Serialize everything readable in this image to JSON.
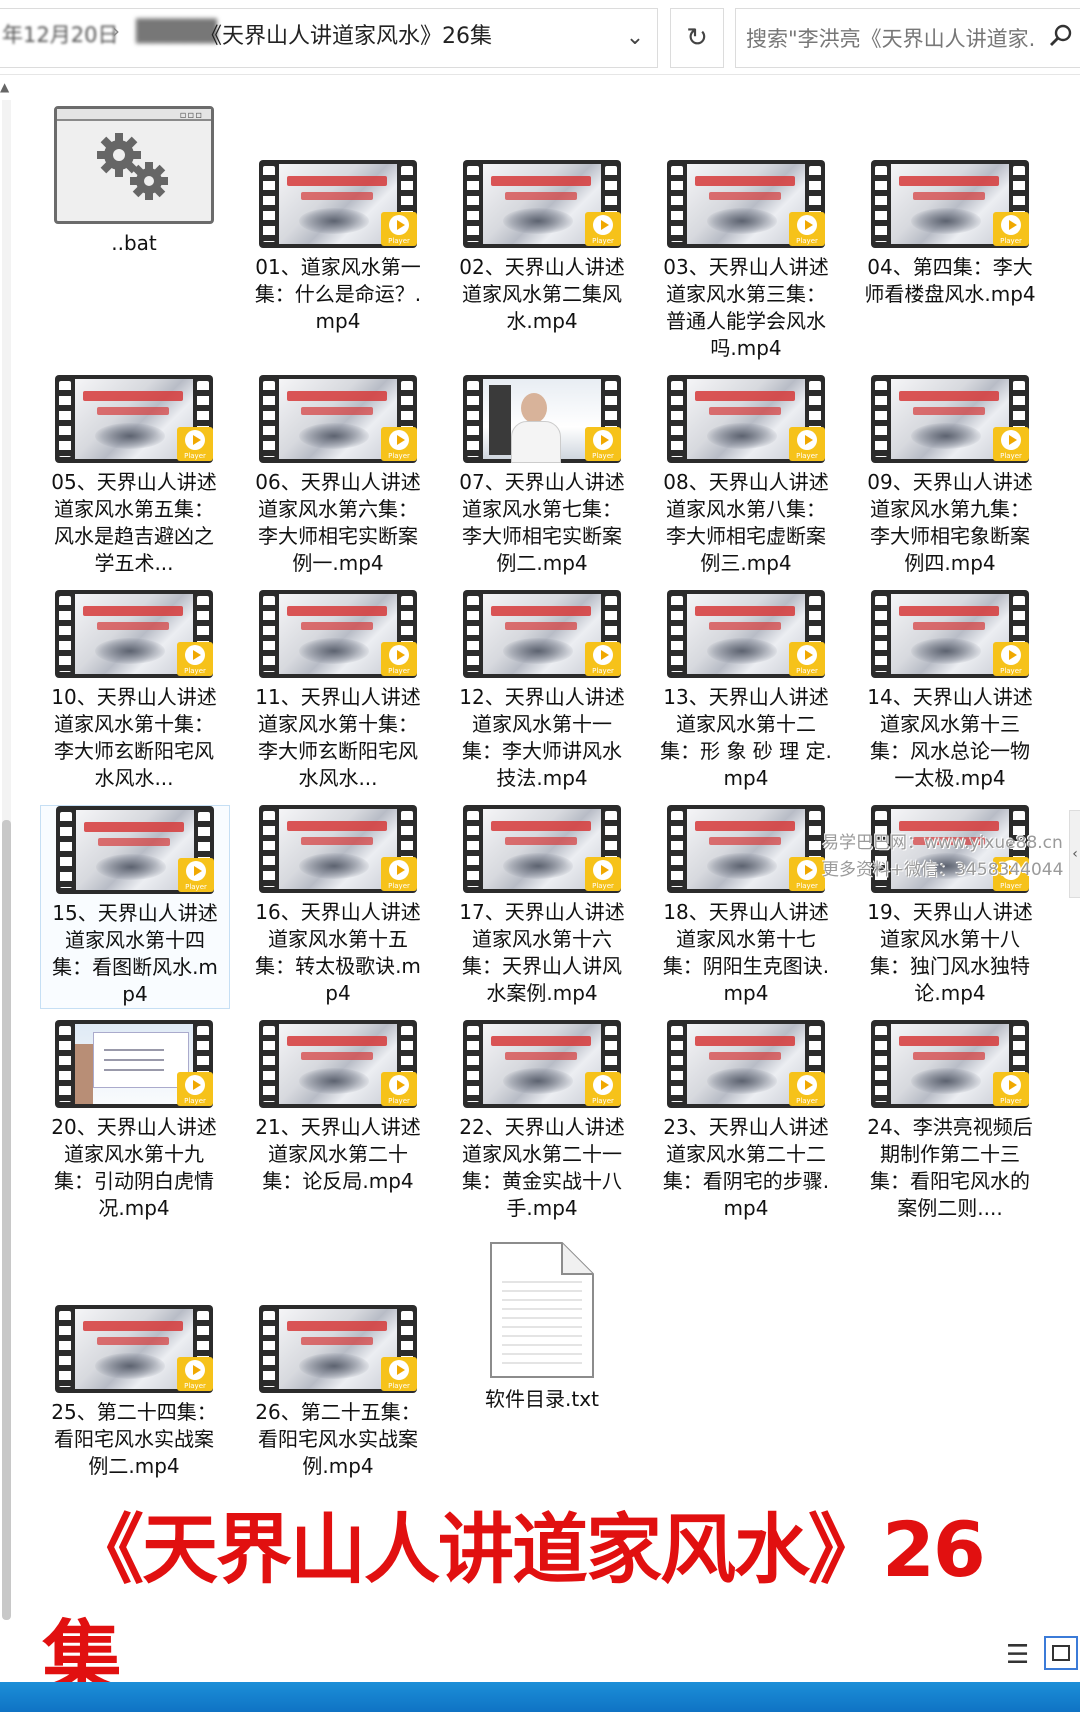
{
  "address_bar": {
    "date_crumb": "年12月20日",
    "separator": "›",
    "blurred_crumb": "█████",
    "title_prefix": "█████",
    "title": "《天界山人讲道家风水》26集",
    "dropdown_icon": "chevron-down-icon",
    "refresh_icon": "refresh-icon"
  },
  "search": {
    "placeholder": "搜索\"李洪亮《天界山人讲道家...",
    "icon": "search-icon"
  },
  "files": [
    {
      "label": "..bat",
      "icon": "gear-file-icon"
    },
    {
      "label": "01、道家风水第一集：什么是命运？.mp4",
      "thumb": "ink"
    },
    {
      "label": "02、天界山人讲述道家风水第二集风水.mp4",
      "thumb": "ink"
    },
    {
      "label": "03、天界山人讲述道家风水第三集：普通人能学会风水吗.mp4",
      "thumb": "ink"
    },
    {
      "label": "04、第四集：李大师看楼盘风水.mp4",
      "thumb": "ink"
    },
    {
      "label": "05、天界山人讲述道家风水第五集：风水是趋吉避凶之学五术...",
      "thumb": "ink"
    },
    {
      "label": "06、天界山人讲述道家风水第六集：李大师相宅实断案例一.mp4",
      "thumb": "ink"
    },
    {
      "label": "07、天界山人讲述道家风水第七集：李大师相宅实断案例二.mp4",
      "thumb": "person"
    },
    {
      "label": "08、天界山人讲述道家风水第八集：李大师相宅虚断案例三.mp4",
      "thumb": "ink"
    },
    {
      "label": "09、天界山人讲述道家风水第九集：李大师相宅象断案例四.mp4",
      "thumb": "ink"
    },
    {
      "label": "10、天界山人讲述道家风水第十集：李大师玄断阳宅风水风水...",
      "thumb": "ink"
    },
    {
      "label": "11、天界山人讲述道家风水第十集：李大师玄断阳宅风水风水...",
      "thumb": "ink"
    },
    {
      "label": "12、天界山人讲述道家风水第十一集：李大师讲风水技法.mp4",
      "thumb": "ink"
    },
    {
      "label": "13、天界山人讲述道家风水第十二集：形 象 砂 理 定.mp4",
      "thumb": "ink"
    },
    {
      "label": "14、天界山人讲述道家风水第十三集：风水总论一物一太极.mp4",
      "thumb": "ink"
    },
    {
      "label": "15、天界山人讲述道家风水第十四集：看图断风水.mp4",
      "thumb": "ink",
      "selected": true
    },
    {
      "label": "16、天界山人讲述道家风水第十五集：转太极歌诀.mp4",
      "thumb": "ink"
    },
    {
      "label": "17、天界山人讲述道家风水第十六集：天界山人讲风水案例.mp4",
      "thumb": "ink"
    },
    {
      "label": "18、天界山人讲述道家风水第十七集：阴阳生克图诀.mp4",
      "thumb": "ink"
    },
    {
      "label": "19、天界山人讲述道家风水第十八集：独门风水独特论.mp4",
      "thumb": "ink"
    },
    {
      "label": "20、天界山人讲述道家风水第十九集：引动阴白虎情况.mp4",
      "thumb": "lecture"
    },
    {
      "label": "21、天界山人讲述道家风水第二十集：论反局.mp4",
      "thumb": "ink"
    },
    {
      "label": "22、天界山人讲述道家风水第二十一集：黄金实战十八手.mp4",
      "thumb": "ink"
    },
    {
      "label": "23、天界山人讲述道家风水第二十二集：看阴宅的步骤.mp4",
      "thumb": "ink"
    },
    {
      "label": "24、李洪亮视频后期制作第二十三集：看阳宅风水的案例二则....",
      "thumb": "ink"
    },
    {
      "label": "25、第二十四集：看阳宅风水实战案例二.mp4",
      "thumb": "ink"
    },
    {
      "label": "26、第二十五集：看阳宅风水实战案例.mp4",
      "thumb": "ink"
    },
    {
      "label": "软件目录.txt",
      "icon": "text-file-icon"
    }
  ],
  "player_badge": "Player",
  "watermark": {
    "line1": "易学巴巴网：www.yixue88.cn",
    "line2": "更多资料+微信：3458344044"
  },
  "caption": {
    "line1": "《天界山人讲道家风水》26",
    "line2": "集"
  },
  "view_toggle": {
    "details_icon": "details-view-icon",
    "thumbnails_icon": "large-icons-view-icon"
  },
  "colors": {
    "caption_red": "#e11010",
    "player_yellow": "#f6c21a",
    "taskbar_blue": "#1c8fd8"
  }
}
